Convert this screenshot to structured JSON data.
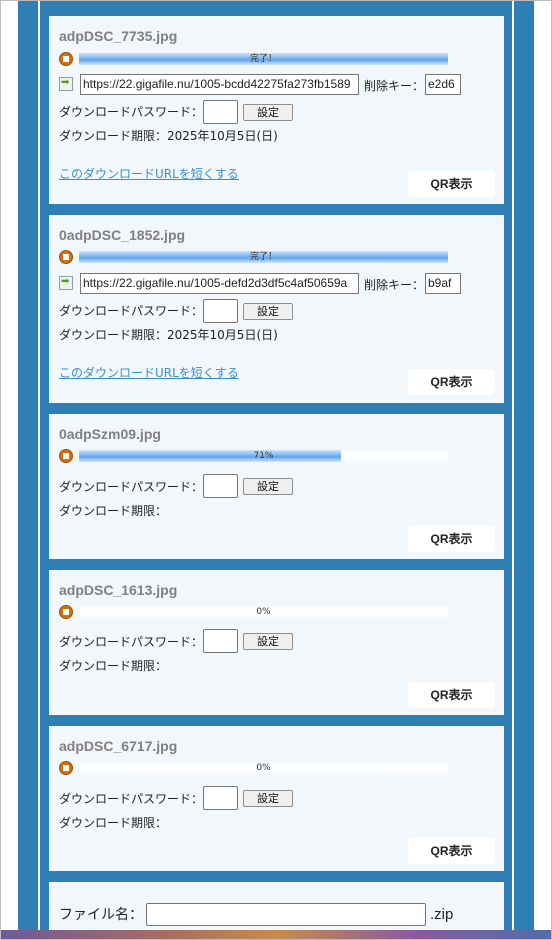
{
  "uploads": [
    {
      "filename": "adpDSC_7735.jpg",
      "progress_text": "完了！",
      "progress_fraction": 1.0,
      "url": "https://22.gigafile.nu/1005-bcdd42275fa273fb1589",
      "delete_key_label": "削除キー：",
      "delete_key": "e2d6",
      "password_label": "ダウンロードパスワード：",
      "set_button": "設定",
      "expiry_label": "ダウンロード期限：2025年10月5日(日)",
      "shorten_link": "このダウンロードURLを短くする",
      "qr_button": "QR表示"
    },
    {
      "filename": "0adpDSC_1852.jpg",
      "progress_text": "完了！",
      "progress_fraction": 1.0,
      "url": "https://22.gigafile.nu/1005-defd2d3df5c4af50659a",
      "delete_key_label": "削除キー：",
      "delete_key": "b9af",
      "password_label": "ダウンロードパスワード：",
      "set_button": "設定",
      "expiry_label": "ダウンロード期限：2025年10月5日(日)",
      "shorten_link": "このダウンロードURLを短くする",
      "qr_button": "QR表示"
    },
    {
      "filename": "0adpSzm09.jpg",
      "progress_text": "71%",
      "progress_fraction": 0.71,
      "password_label": "ダウンロードパスワード：",
      "set_button": "設定",
      "expiry_label": "ダウンロード期限：",
      "qr_button": "QR表示"
    },
    {
      "filename": "adpDSC_1613.jpg",
      "progress_text": "0%",
      "progress_fraction": 0.0,
      "password_label": "ダウンロードパスワード：",
      "set_button": "設定",
      "expiry_label": "ダウンロード期限：",
      "qr_button": "QR表示"
    },
    {
      "filename": "adpDSC_6717.jpg",
      "progress_text": "0%",
      "progress_fraction": 0.0,
      "password_label": "ダウンロードパスワード：",
      "set_button": "設定",
      "expiry_label": "ダウンロード期限：",
      "qr_button": "QR表示"
    }
  ],
  "zip": {
    "label": "ファイル名：",
    "value": "",
    "suffix": ".zip"
  },
  "colors": {
    "column": "#2f7fb4",
    "card": "#f2f7fb",
    "link": "#3a8fd0",
    "stop_icon": "#d2700d",
    "progress_fill": "#5ea3ea"
  },
  "icons": {
    "stop": "stop-upload-icon",
    "go": "open-url-icon"
  }
}
